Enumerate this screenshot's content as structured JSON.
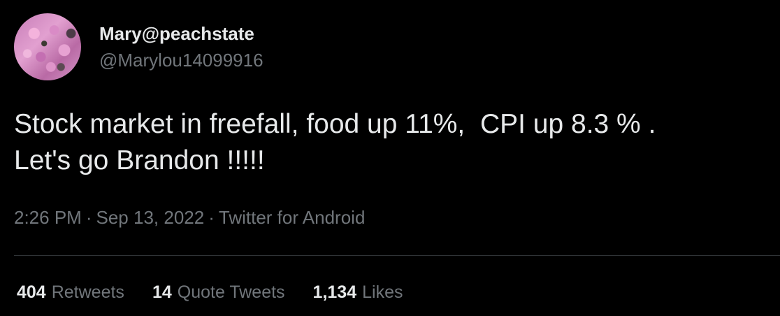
{
  "author": {
    "display_name": "Mary@peachstate",
    "handle": "@Marylou14099916"
  },
  "tweet": {
    "text_line1": "Stock market in freefall, food up 11%,  CPI up 8.3 % .",
    "text_line2": "Let's go Brandon !!!!!"
  },
  "meta": {
    "time": "2:26 PM",
    "separator": "·",
    "date": "Sep 13, 2022",
    "source": "Twitter for Android"
  },
  "stats": {
    "retweets": {
      "count": "404",
      "label": "Retweets"
    },
    "quote_tweets": {
      "count": "14",
      "label": "Quote Tweets"
    },
    "likes": {
      "count": "1,134",
      "label": "Likes"
    }
  },
  "colors": {
    "background": "#000000",
    "primary_text": "#e7e9ea",
    "secondary_text": "#71767b",
    "divider": "#2f3336"
  }
}
